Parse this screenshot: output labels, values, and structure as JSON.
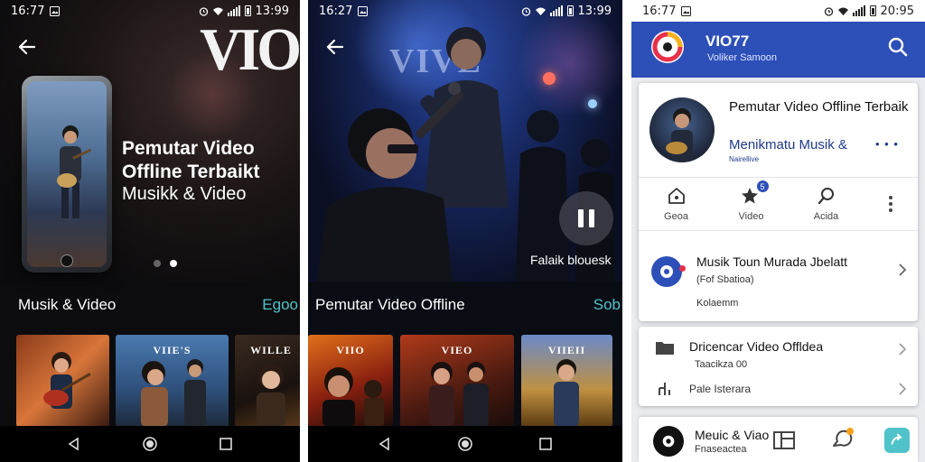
{
  "screen1": {
    "status": {
      "time": "16:77",
      "battery": "13:99"
    },
    "hero": {
      "logo": "VIO",
      "title": "Pemutar Video Offline Terbaikt",
      "subtitle": "Musikk & Video",
      "slide_count": 2,
      "active_slide": 2
    },
    "row": {
      "title": "Musik & Video",
      "more": "Egoo",
      "thumbs": [
        {
          "title": ""
        },
        {
          "title": "VIIE'S"
        },
        {
          "title": "WILLE"
        }
      ]
    }
  },
  "screen2": {
    "status": {
      "time": "16:27",
      "battery": "13:99"
    },
    "stage": {
      "sign": "VIVE",
      "caption": "Falaik blouesk"
    },
    "row": {
      "title": "Pemutar Video Offline",
      "more": "Sob",
      "thumbs": [
        {
          "title": "VIIO"
        },
        {
          "title": "VIEO"
        },
        {
          "title": "VIIEII"
        }
      ]
    }
  },
  "screen3": {
    "status": {
      "time": "16:77",
      "battery": "20:95"
    },
    "appbar": {
      "name": "VIO77",
      "subtitle": "Voliker Samoon"
    },
    "profile": {
      "title": "Pemutar Video Offline Terbaik",
      "subtitle": "Menikmatu Musik &",
      "subtitle2": "Nairellive",
      "dots": "• • •"
    },
    "actions": [
      {
        "label": "Geoa",
        "icon": "home-icon"
      },
      {
        "label": "Video",
        "icon": "star-icon",
        "badge": "5"
      },
      {
        "label": "Acida",
        "icon": "search-icon"
      }
    ],
    "list1": {
      "title": "Musik Toun Murada Jbelatt",
      "subtitle": "(Fof Sbatioa)",
      "meta": "Kolaemm"
    },
    "list2": {
      "title": "Dricencar Video Offldea",
      "subtitle": "Taacikza 00"
    },
    "list3": {
      "title": "Pale Isterara"
    },
    "bottom": {
      "title": "Meuic & Viao",
      "subtitle": "Fnaseactea",
      "sub2": "……"
    }
  },
  "colors": {
    "accent_teal": "#4fc3c9",
    "app_blue": "#2d4fb8",
    "link_blue": "#1e3a8a"
  }
}
